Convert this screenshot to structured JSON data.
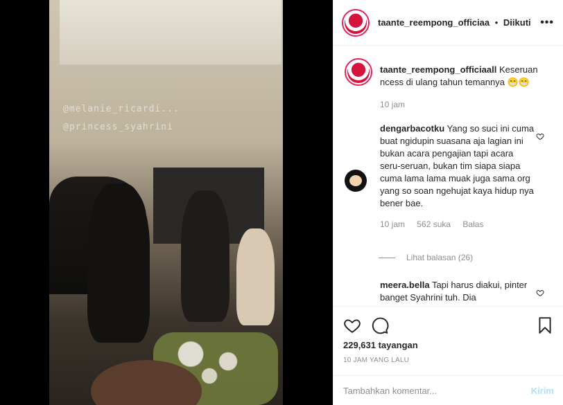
{
  "post": {
    "username": "taante_reempong_officiaa",
    "separator": "•",
    "follow_state": "Diikuti",
    "more_label": "•••"
  },
  "caption": {
    "username": "taante_reempong_officiaall",
    "text": "Keseruan ncess di ulang tahun temannya 😁😁",
    "time": "10 jam"
  },
  "comments": [
    {
      "username": "dengarbacotku",
      "text": "Yang so suci ini cuma buat ngidupin suasana aja lagian ini bukan acara pengajian tapi acara seru-seruan, bukan tim siapa siapa cuma lama lama muak juga sama org yang so soan ngehujat kaya hidup nya bener bae.",
      "time": "10 jam",
      "likes": "562 suka",
      "reply_label": "Balas",
      "view_replies": "Lihat balasan (26)"
    },
    {
      "username": "meera.bella",
      "text": "Tapi harus diakui, pinter banget Syahrini tuh. Dia"
    }
  ],
  "video": {
    "watermark_1": "@melanie_ricardi...",
    "watermark_2": "@princess_syahrini"
  },
  "stats": {
    "views": "229,631 tayangan",
    "time_ago": "10 JAM YANG LALU"
  },
  "composer": {
    "placeholder": "Tambahkan komentar...",
    "post_label": "Kirim"
  },
  "colors": {
    "link_blue_disabled": "#b2dffc",
    "muted": "#8e8e8e",
    "text": "#262626",
    "border": "#efefef"
  }
}
